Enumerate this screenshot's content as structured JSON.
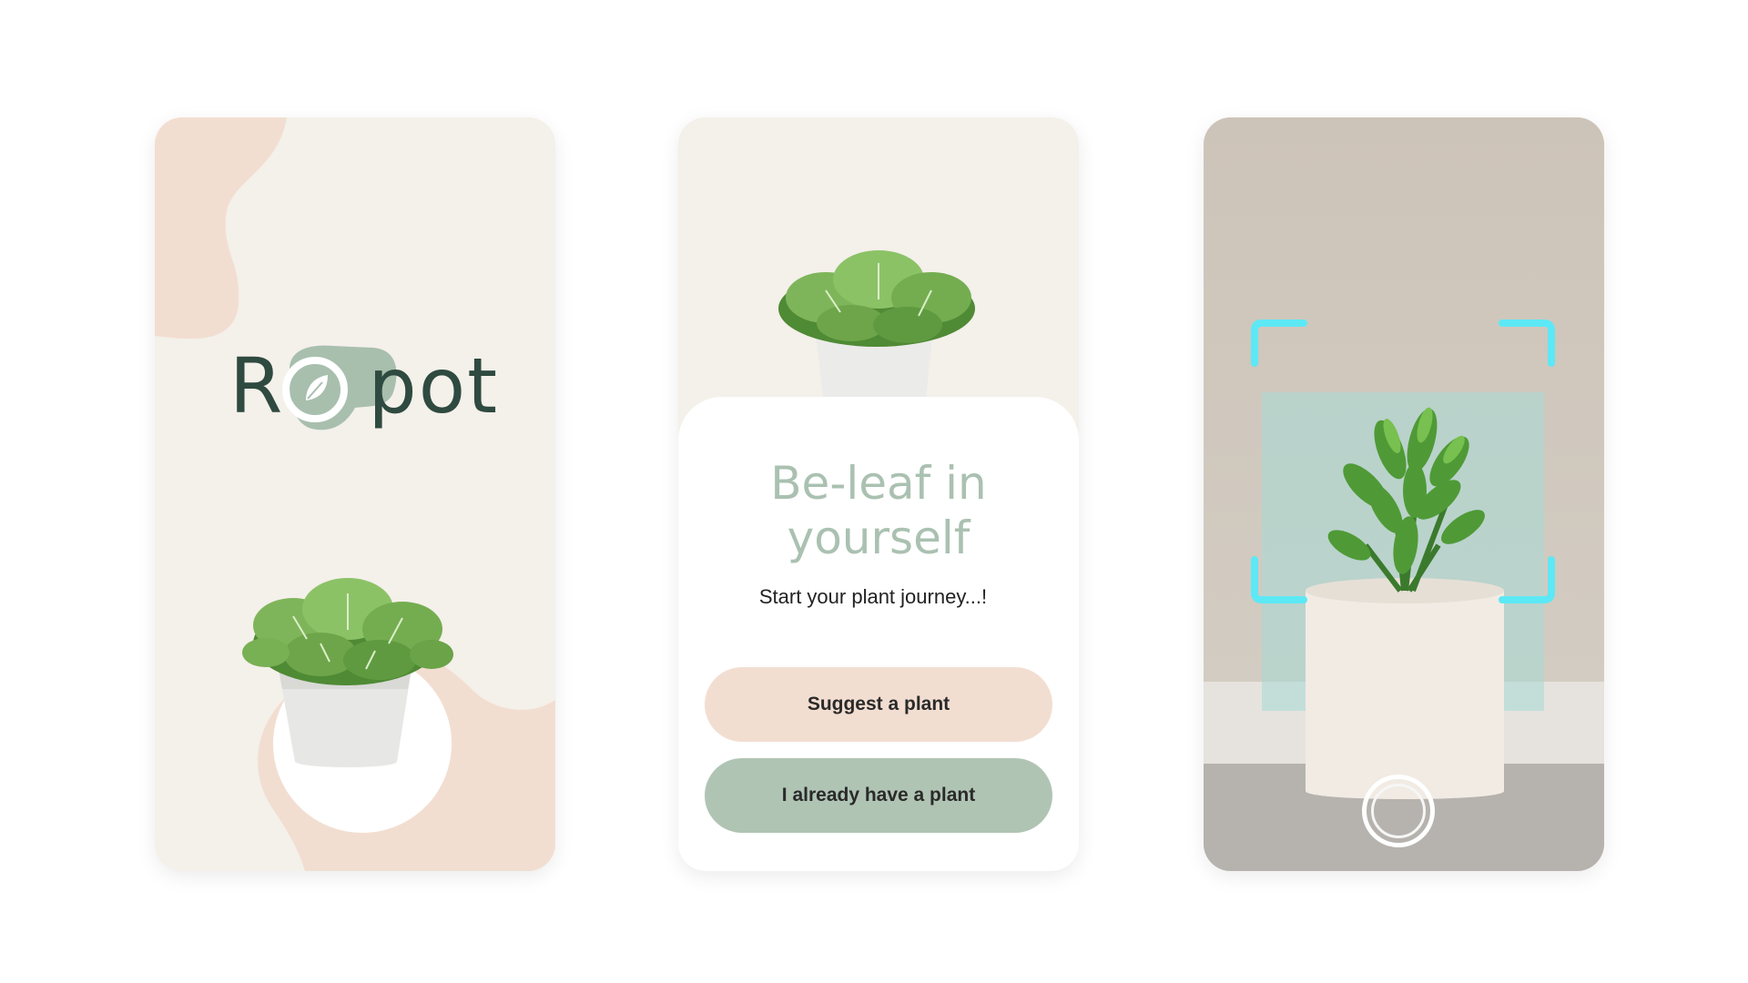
{
  "splash": {
    "logo_letter_r": "R",
    "logo_letters_pot": "pot",
    "logo_icon": "leaf-icon"
  },
  "welcome": {
    "headline": "Be-leaf in yourself",
    "subline": "Start your plant journey...!",
    "suggest_button": "Suggest a plant",
    "have_button": "I already have a plant"
  },
  "scan": {
    "frame_icon": "scan-frame-corners",
    "shutter_icon": "camera-shutter-icon"
  },
  "colors": {
    "cream": "#f4f0ea",
    "peach": "#f2ded1",
    "sage": "#b0c4b4",
    "dark_green": "#2f4a40",
    "scan_cyan": "#5de8f5"
  }
}
